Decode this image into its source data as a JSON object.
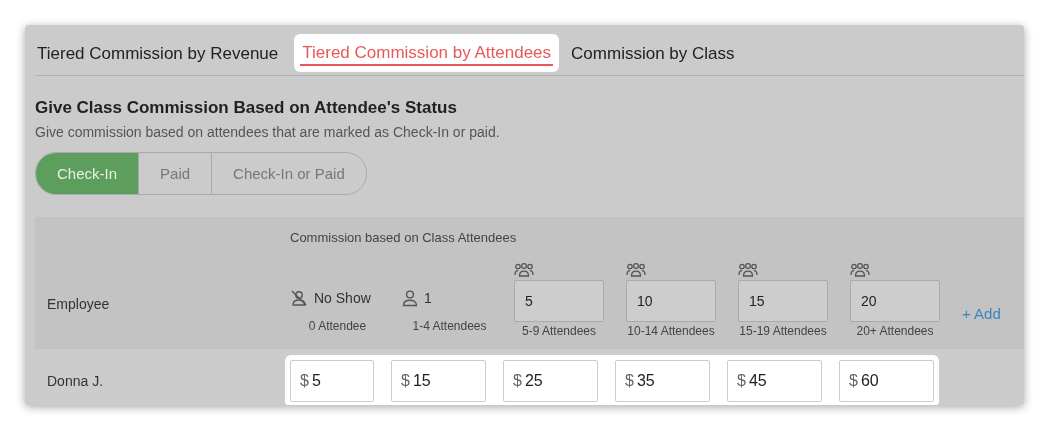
{
  "tabs": [
    {
      "label": "Tiered Commission by Revenue",
      "selected": false
    },
    {
      "label": "Tiered Commission by Attendees",
      "selected": true
    },
    {
      "label": "Commission by Class",
      "selected": false
    }
  ],
  "heading": "Give Class Commission Based on Attendee's Status",
  "description": "Give commission based on attendees that are marked as Check-In or paid.",
  "status_options": [
    {
      "label": "Check-In",
      "selected": true
    },
    {
      "label": "Paid",
      "selected": false
    },
    {
      "label": "Check-In or Paid",
      "selected": false
    }
  ],
  "table": {
    "employee_header": "Employee",
    "group_header": "Commission based on Class Attendees",
    "tiers": [
      {
        "kind": "no_show",
        "label": "No Show",
        "sublabel": "0 Attendee"
      },
      {
        "kind": "single",
        "label": "1",
        "sublabel": "1-4 Attendees"
      },
      {
        "kind": "range",
        "value": "5",
        "sublabel": "5-9 Attendees"
      },
      {
        "kind": "range",
        "value": "10",
        "sublabel": "10-14 Attendees"
      },
      {
        "kind": "range",
        "value": "15",
        "sublabel": "15-19 Attendees"
      },
      {
        "kind": "range",
        "value": "20",
        "sublabel": "20+ Attendees"
      }
    ],
    "add_label": "+ Add",
    "rows": [
      {
        "name": "Donna J.",
        "amounts": [
          {
            "currency": "$",
            "value": "5"
          },
          {
            "currency": "$",
            "value": "15"
          },
          {
            "currency": "$",
            "value": "25"
          },
          {
            "currency": "$",
            "value": "35"
          },
          {
            "currency": "$",
            "value": "45"
          },
          {
            "currency": "$",
            "value": "60"
          }
        ]
      }
    ]
  }
}
